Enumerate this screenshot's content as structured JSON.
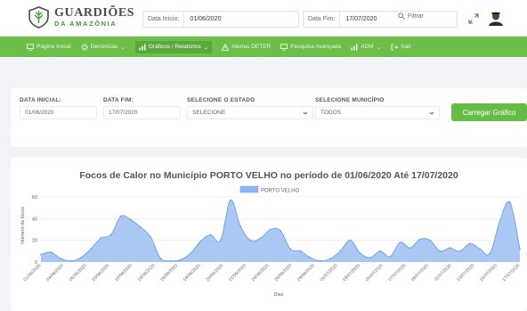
{
  "header": {
    "logo_line1": "GUARDIÕES",
    "logo_line2": "DA AMAZÔNIA",
    "start_label": "Data Início:",
    "start_value": "01/06/2020",
    "end_label": "Data Fim:",
    "end_value": "17/07/2020",
    "filter_label": "Filtrar",
    "icons": {
      "search": "search-icon",
      "expand": "expand-icon",
      "user": "user-avatar"
    }
  },
  "nav": {
    "items": [
      {
        "label": "Página Inicial",
        "icon": "monitor-icon"
      },
      {
        "label": "Denúncias",
        "icon": "gear-icon",
        "dropdown": true
      },
      {
        "label": "Gráficos / Relatórios",
        "icon": "bar-chart-icon",
        "dropdown": true,
        "active": true
      },
      {
        "label": "Alertas DETER",
        "icon": "warning-icon"
      },
      {
        "label": "Pesquisa Avançada",
        "icon": "monitor-icon"
      },
      {
        "label": "ADM",
        "icon": "bar-chart-icon",
        "dropdown": true
      },
      {
        "label": "Sair",
        "icon": "logout-icon"
      }
    ],
    "color": "#6dbf4a"
  },
  "filters": {
    "start_label": "DATA INICIAL:",
    "start_value": "01/06/2020",
    "end_label": "DATA FIM:",
    "end_value": "17/07/2020",
    "state_label": "SELECIONE O ESTADO",
    "state_value": "SELECIONE",
    "municipality_label": "SELECIONE MUNICÍPIO",
    "municipality_value": "TODOS",
    "button_label": "Carregar Gráfico",
    "button_color": "#66bd46"
  },
  "chart_data": {
    "type": "area",
    "title": "Focos de Calor no Município PORTO VELHO no período de 01/06/2020 Até  17/07/2020",
    "xlabel": "Dias",
    "ylabel": "Número de focos",
    "ylim": [
      0,
      60
    ],
    "yticks": [
      0,
      20,
      40,
      60
    ],
    "grid": true,
    "legend_position": "top-center",
    "series": [
      {
        "name": "PORTO VELHO",
        "color": "#8fb6f0",
        "values": [
          7,
          9,
          3,
          1,
          4,
          12,
          22,
          25,
          42,
          39,
          32,
          23,
          3,
          1,
          2,
          8,
          19,
          25,
          20,
          57,
          33,
          20,
          22,
          30,
          29,
          12,
          10,
          4,
          1,
          3,
          10,
          20,
          8,
          4,
          10,
          5,
          18,
          13,
          21,
          20,
          10,
          13,
          10,
          17,
          12,
          8,
          38,
          55,
          12
        ]
      }
    ],
    "x_tick_labels": [
      "01/06/2020",
      "04/06/2020",
      "06/06/2020",
      "10/06/2020",
      "12/06/2020",
      "14/06/2020",
      "16/06/2020",
      "18/06/2020",
      "20/06/2020",
      "22/06/2020",
      "24/06/2020",
      "26/06/2020",
      "28/06/2020",
      "01/07/2020",
      "03/07/2020",
      "05/07/2020",
      "07/07/2020",
      "09/07/2020",
      "11/07/2020",
      "13/07/2020",
      "15/07/2020",
      "17/07/2020"
    ]
  }
}
